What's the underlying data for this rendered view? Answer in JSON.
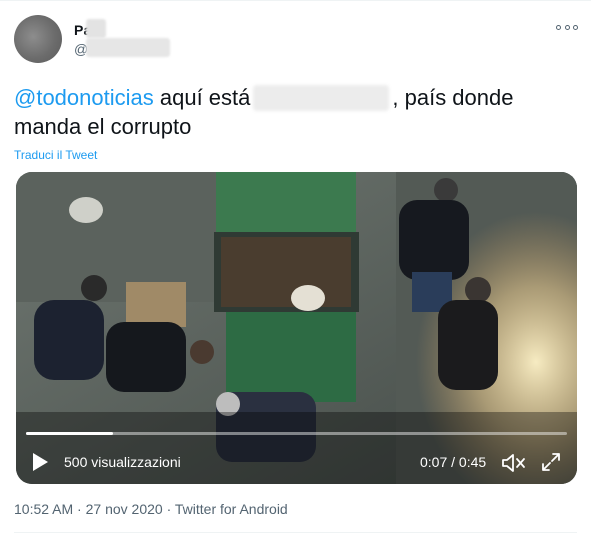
{
  "author": {
    "display_name": "Pa",
    "handle": "@"
  },
  "tweet": {
    "mention": "@todonoticias",
    "text_part1": " aquí está",
    "text_part2": ", país donde manda el corrupto",
    "translate_label": "Traduci il Tweet"
  },
  "video": {
    "views_label": "500 visualizzazioni",
    "time_label": "0:07 / 0:45",
    "progress_fraction": 0.16
  },
  "meta": {
    "time": "10:52 AM",
    "separator": " · ",
    "date": "27 nov 2020",
    "source": "Twitter for Android"
  },
  "icons": {
    "more": "more-horizontal-icon",
    "play": "play-icon",
    "mute": "volume-muted-icon",
    "fullscreen": "fullscreen-icon"
  },
  "colors": {
    "accent": "#1d9bf0",
    "secondary_text": "#536471"
  }
}
